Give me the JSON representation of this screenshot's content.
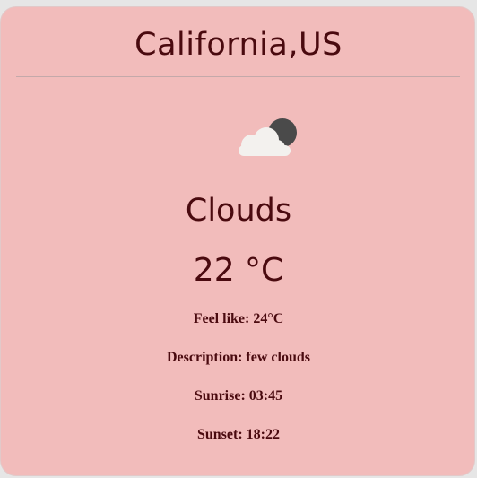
{
  "weather": {
    "location": "California,US",
    "condition": "Clouds",
    "icon": "few-clouds-night-icon",
    "temperature_value": "22",
    "temperature_unit": "°C",
    "temperature_display": "22 °C",
    "feels_like": "Feel like: 24°C",
    "description": "Description: few clouds",
    "sunrise": "Sunrise: 03:45",
    "sunset": "Sunset: 18:22"
  },
  "colors": {
    "card_background": "#f2bcbb",
    "text": "#4a0a0f",
    "page_background": "#e6e6e6",
    "divider": "#c4a9aa",
    "cloud": "#f3f1ee",
    "moon": "#4a4a4a"
  }
}
